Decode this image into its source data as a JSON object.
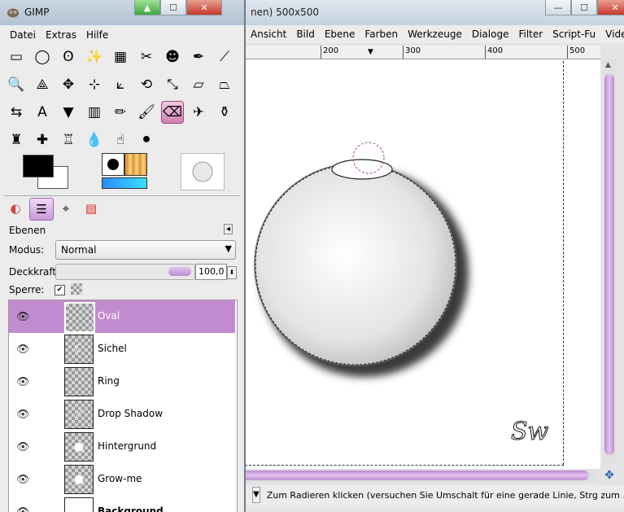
{
  "image_window": {
    "title": "nen) 500x500",
    "controls": {
      "minimize": "—",
      "maximize": "☐",
      "close": "✕"
    },
    "menu": [
      "Ansicht",
      "Bild",
      "Ebene",
      "Farben",
      "Werkzeuge",
      "Dialoge",
      "Filter",
      "Script-Fu",
      "Video"
    ],
    "ruler_labels": [
      "200",
      "300",
      "400",
      "500"
    ],
    "status": {
      "unit_arrow": "▼",
      "message": "Zum Radieren klicken (versuchen Sie Umschalt für eine gerade Linie, Strg zum ..."
    },
    "canvas_signature": "Sw"
  },
  "toolbox": {
    "title": "GIMP",
    "controls": {
      "minimize": "▲",
      "maximize": "☐",
      "close": "✕"
    },
    "menu": [
      "Datei",
      "Extras",
      "Hilfe"
    ],
    "tools": [
      {
        "name": "rect-select-icon",
        "glyph": "▭"
      },
      {
        "name": "ellipse-select-icon",
        "glyph": "◯"
      },
      {
        "name": "lasso-icon",
        "glyph": "ʘ"
      },
      {
        "name": "fuzzy-select-icon",
        "glyph": "✨"
      },
      {
        "name": "color-select-icon",
        "glyph": "▦"
      },
      {
        "name": "scissors-icon",
        "glyph": "✂"
      },
      {
        "name": "foreground-select-icon",
        "glyph": "☻"
      },
      {
        "name": "paths-icon",
        "glyph": "✒"
      },
      {
        "name": "color-picker-icon",
        "glyph": "⟋"
      },
      {
        "name": "zoom-icon",
        "glyph": "🔍"
      },
      {
        "name": "measure-icon",
        "glyph": "⟁"
      },
      {
        "name": "move-icon",
        "glyph": "✥"
      },
      {
        "name": "align-icon",
        "glyph": "⊹"
      },
      {
        "name": "crop-icon",
        "glyph": "⟀"
      },
      {
        "name": "rotate-icon",
        "glyph": "⟲"
      },
      {
        "name": "scale-icon",
        "glyph": "⤡"
      },
      {
        "name": "shear-icon",
        "glyph": "▱"
      },
      {
        "name": "perspective-icon",
        "glyph": "⏢"
      },
      {
        "name": "flip-icon",
        "glyph": "⇆"
      },
      {
        "name": "text-icon",
        "glyph": "A"
      },
      {
        "name": "bucket-fill-icon",
        "glyph": "▼"
      },
      {
        "name": "blend-icon",
        "glyph": "▥"
      },
      {
        "name": "pencil-icon",
        "glyph": "✏"
      },
      {
        "name": "paintbrush-icon",
        "glyph": "🖌"
      },
      {
        "name": "eraser-icon",
        "glyph": "⌫"
      },
      {
        "name": "airbrush-icon",
        "glyph": "✈"
      },
      {
        "name": "ink-icon",
        "glyph": "⚱"
      },
      {
        "name": "clone-icon",
        "glyph": "♜"
      },
      {
        "name": "heal-icon",
        "glyph": "✚"
      },
      {
        "name": "perspective-clone-icon",
        "glyph": "♖"
      },
      {
        "name": "blur-icon",
        "glyph": "💧"
      },
      {
        "name": "smudge-icon",
        "glyph": "☝"
      },
      {
        "name": "dodge-burn-icon",
        "glyph": "⚫"
      }
    ],
    "active_tool_index": 24,
    "colors": {
      "foreground": "#000000",
      "background": "#ffffff"
    },
    "dock_tabs": [
      {
        "name": "tool-options-tab-icon",
        "glyph": "◐"
      },
      {
        "name": "layers-tab-icon",
        "glyph": "☰"
      },
      {
        "name": "paths-tab-icon",
        "glyph": "⌖"
      },
      {
        "name": "channels-tab-icon",
        "glyph": "▤"
      }
    ]
  },
  "layers_panel": {
    "title": "Ebenen",
    "menu_arrow": "◂",
    "mode_label": "Modus:",
    "mode_value": "Normal",
    "mode_arrow": "▼",
    "opacity_label": "Deckkraft:",
    "opacity_value": "100,0",
    "opacity_spin": "⬍",
    "lock_label": "Sperre:",
    "lock_checked": "✔",
    "layers": [
      {
        "name": "Oval",
        "selected": true,
        "thumb": ""
      },
      {
        "name": "Sichel",
        "selected": false,
        "thumb": "☾"
      },
      {
        "name": "Ring",
        "selected": false,
        "thumb": ""
      },
      {
        "name": "Drop Shadow",
        "selected": false,
        "thumb": "⟋"
      },
      {
        "name": "Hintergrund",
        "selected": false,
        "thumb": "●"
      },
      {
        "name": "Grow-me",
        "selected": false,
        "thumb": "●"
      },
      {
        "name": "Background",
        "selected": false,
        "thumb": ""
      }
    ]
  }
}
